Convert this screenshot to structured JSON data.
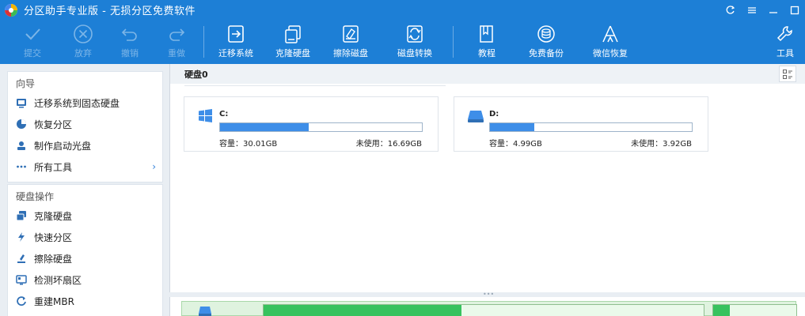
{
  "window": {
    "title": "分区助手专业版 - 无损分区免费软件",
    "icons": [
      "restore-icon",
      "menu-icon",
      "minimize-icon",
      "maximize-icon"
    ]
  },
  "toolbar": {
    "submit": "提交",
    "discard": "放弃",
    "undo": "撤销",
    "redo": "重做",
    "migrate_os": "迁移系统",
    "clone_disk": "克隆硬盘",
    "wipe_disk": "擦除磁盘",
    "convert_disk": "磁盘转换",
    "tutorial": "教程",
    "free_backup": "免费备份",
    "wechat_recovery": "微信恢复",
    "tools": "工具"
  },
  "sidebar": {
    "wizard_heading": "向导",
    "wizard_items": [
      {
        "label": "迁移系统到固态硬盘",
        "icon": "migrate-icon"
      },
      {
        "label": "恢复分区",
        "icon": "recover-partition-icon"
      },
      {
        "label": "制作启动光盘",
        "icon": "boot-disc-icon"
      },
      {
        "label": "所有工具",
        "icon": "more-icon"
      }
    ],
    "disk_ops_heading": "硬盘操作",
    "disk_ops_items": [
      {
        "label": "克隆硬盘",
        "icon": "clone-disk-icon"
      },
      {
        "label": "快速分区",
        "icon": "quick-partition-icon"
      },
      {
        "label": "擦除硬盘",
        "icon": "wipe-disk-icon"
      },
      {
        "label": "检测坏扇区",
        "icon": "bad-sector-icon"
      },
      {
        "label": "重建MBR",
        "icon": "rebuild-mbr-icon"
      }
    ]
  },
  "disk_panel": {
    "disk_name": "硬盘0",
    "partitions": [
      {
        "letter": "C:",
        "capacity": "容量：30.01GB",
        "free": "未使用：16.69GB",
        "used_fraction": 0.44,
        "icon": "windows-icon"
      },
      {
        "letter": "D:",
        "capacity": "容量：4.99GB",
        "free": "未使用：3.92GB",
        "used_fraction": 0.22,
        "icon": "drive-icon"
      }
    ]
  },
  "bottom_panel": {
    "fill_fraction": 0.45,
    "fill2_fraction": 0.2
  },
  "colors": {
    "titlebar": "#1d7fd6",
    "accent": "#3e8ee8",
    "green": "#37c25e"
  }
}
